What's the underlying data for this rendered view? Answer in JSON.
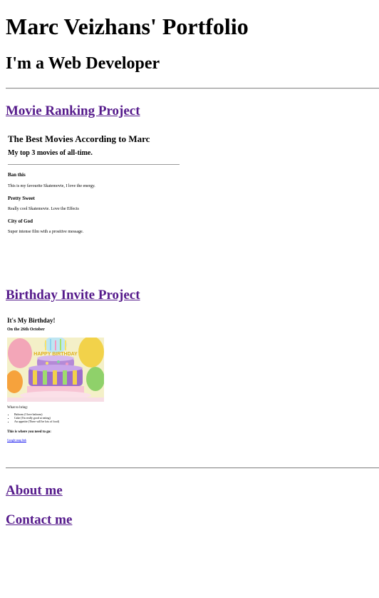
{
  "header": {
    "title": "Marc Veizhans' Portfolio",
    "subtitle": "I'm a Web Developer"
  },
  "projects": [
    {
      "link": "Movie Ranking Project",
      "preview": {
        "title": "The Best Movies According to Marc",
        "subtitle": "My top 3 movies of all-time.",
        "movies": [
          {
            "name": "Ban this",
            "description": "This is my favourite Skatemovie, I love the energy."
          },
          {
            "name": "Pretty Sweet",
            "description": "Really cool Skatemovie. Love the Effects"
          },
          {
            "name": "City of God",
            "description": "Super intense film with a prositive message."
          }
        ]
      }
    },
    {
      "link": "Birthday Invite Project",
      "preview": {
        "title": "It's My Birthday!",
        "date": "On the 26th October",
        "image_text": "HAPPY BIRTHDAY",
        "bring_label": "What to bring:",
        "bring_items": [
          "Baloons (I love baloons)",
          "Cake (I'm really good at eating)",
          "An appetite (There will be lots of food)"
        ],
        "where_label": "This is where you need to go:",
        "map_link": "Google map link"
      }
    }
  ],
  "nav": {
    "about": "About me",
    "contact": "Contact me"
  },
  "colors": {
    "visited_link": "#551a8b",
    "link": "#0000ee",
    "rule": "#8c8c8c"
  }
}
